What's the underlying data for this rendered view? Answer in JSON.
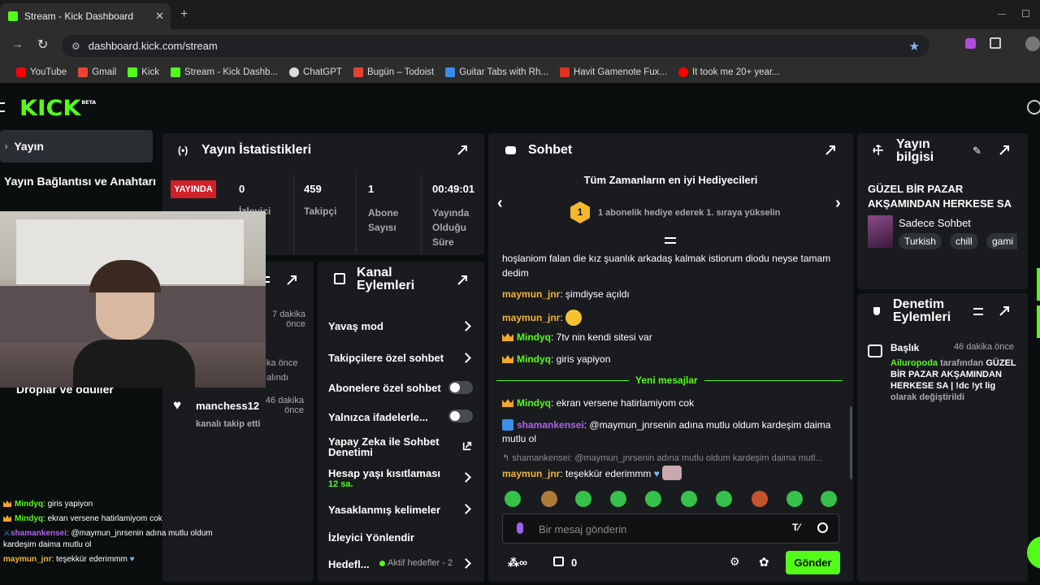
{
  "browser": {
    "tab_title": "Stream - Kick Dashboard",
    "url": "dashboard.kick.com/stream",
    "bookmarks": [
      "YouTube",
      "Gmail",
      "Kick",
      "Stream - Kick Dashb...",
      "ChatGPT",
      "Bugün – Todoist",
      "Guitar Tabs with Rh...",
      "Havit Gamenote Fux...",
      "It took me 20+ year..."
    ]
  },
  "kick": {
    "logo": "KICK",
    "logo_badge": "BETA",
    "brand_color": "#53fc18"
  },
  "sidebar": {
    "item_stream": "Yayın",
    "item_keys": "Yayın Bağlantısı ve Anahtarı",
    "item_drops": "Droplar ve ödüller"
  },
  "stats": {
    "title": "Yayın İstatistikleri",
    "live_badge": "YAYINDA",
    "viewers_value": "0",
    "viewers_label": "İzleyici",
    "followers_value": "459",
    "followers_label": "Takipçi",
    "subs_value": "1",
    "subs_label": "Abone Sayısı",
    "duration_value": "00:49:01",
    "duration_label": "Yayında Olduğu Süre"
  },
  "activity": {
    "item1_time": "7 dakika önce",
    "item2_time": "kika önce",
    "item2_text": "alındı",
    "item3_user": "manchess12",
    "item3_time": "46 dakika önce",
    "item3_text": "kanalı takip etti"
  },
  "actions": {
    "title": "Kanal Eylemleri",
    "slow_mode": "Yavaş mod",
    "followers_only": "Takipçilere özel sohbet",
    "subs_only": "Abonelere özel sohbet",
    "emotes_only": "Yalnızca ifadelerle...",
    "ai_moderation": "Yapay Zeka ile Sohbet Denetimi",
    "account_age": "Hesap yaşı kısıtlaması",
    "account_age_value": "12 sa.",
    "banned_words": "Yasaklanmış kelimeler",
    "raid": "İzleyici Yönlendir",
    "goals": "Hedefl...",
    "goals_status": "Aktif hedefler - 2"
  },
  "chat": {
    "title": "Sohbet",
    "gifters_title": "Tüm Zamanların en iyi Hediyecileri",
    "gifters_text": "1 abonelik hediye ederek 1. sıraya yükselin",
    "gifters_rank": "1",
    "msg0_text": "hoşlaniom falan die kız şuanlık arkadaş kalmak istiorum diodu neyse tamam",
    "msg0_text2": "dedim",
    "msg1_user": "maymun_jnr",
    "msg1_text": "şimdiyse açıldı",
    "msg2_user": "maymun_jnr",
    "msg3_user": "Mindyq",
    "msg3_text": "7tv nin kendi sitesi var",
    "msg4_user": "Mindyq",
    "msg4_text": "giris yapiyon",
    "new_messages": "Yeni mesajlar",
    "msg5_user": "Mindyq",
    "msg5_text": "ekran versene hatirlamiyom cok",
    "msg6_user": "shamankensei",
    "msg6_text": "@maymun_jnrsenin adına mutlu oldum kardeşim daima",
    "msg6_text2": "mutlu ol",
    "reply_ref": "shamankensei: @maymun_jnrsenin adına mutlu oldum kardeşim daima mutl...",
    "msg7_user": "maymun_jnr",
    "msg7_text": "teşekkür ederimmm",
    "input_placeholder": "Bir mesaj gönderin",
    "points_value": "0",
    "send_label": "Gönder"
  },
  "info": {
    "title": "Yayın bilgisi",
    "stream_title": "GÜZEL BİR PAZAR AKŞAMINDAN HERKESE SA ...",
    "category": "Sadece Sohbet",
    "tags": [
      "Turkish",
      "chill",
      "gami"
    ]
  },
  "moderation": {
    "title": "Denetim Eylemleri",
    "event_label": "Başlık",
    "event_time": "46 dakika önce",
    "event_user": "Ailuropoda",
    "event_by": "tarafından",
    "event_value": "GÜZEL BİR PAZAR AKŞAMINDAN HERKESE SA | !dc !yt lig",
    "event_suffix": "olarak değiştirildi"
  },
  "overlay": {
    "l1_user": "Mindyq",
    "l1_text": "giris yapiyon",
    "l2_user": "Mindyq",
    "l2_text": "ekran versene hatirlamiyom cok",
    "l3_user": "shamankensei",
    "l3_text": "@maymun_jnrsenin adına mutlu oldum",
    "l3_text2": "kardeşim daima mutlu ol",
    "l4_user": "maymun_jnr",
    "l4_text": "teşekkür ederimmm"
  }
}
